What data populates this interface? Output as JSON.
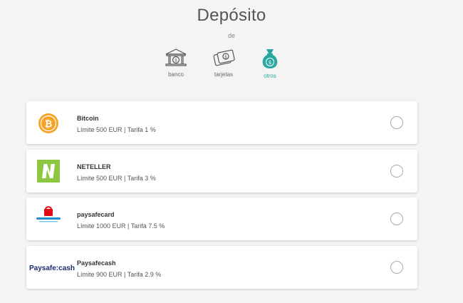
{
  "header": {
    "title": "Depósito",
    "subtitle": "de"
  },
  "tabs": [
    {
      "label": "banco",
      "icon": "bank-icon",
      "active": false
    },
    {
      "label": "tarjetas",
      "icon": "card-icon",
      "active": false
    },
    {
      "label": "otros",
      "icon": "money-bag-icon",
      "active": true
    }
  ],
  "methods": [
    {
      "name": "Bitcoin",
      "limits": "Límite 500 EUR | Tarifa 1 %",
      "icon": "bitcoin-icon"
    },
    {
      "name": "NETELLER",
      "limits": "Límite 500 EUR | Tarifa 3 %",
      "icon": "neteller-logo"
    },
    {
      "name": "paysafecard",
      "limits": "Límite 1000 EUR | Tarifa 7.5 %",
      "icon": "paysafecard-logo"
    },
    {
      "name": "Paysafecash",
      "limits": "Límite 900 EUR | Tarifa 2.9 %",
      "icon": "paysafecash-logo"
    }
  ],
  "logos": {
    "paysafecash_text": "Paysafe:cash"
  },
  "colors": {
    "accent": "#2aa7a0",
    "bitcoin": "#f7a325",
    "neteller": "#8dc63f",
    "paysafecard": "#e30613",
    "paysafecash": "#1b2a6b"
  }
}
